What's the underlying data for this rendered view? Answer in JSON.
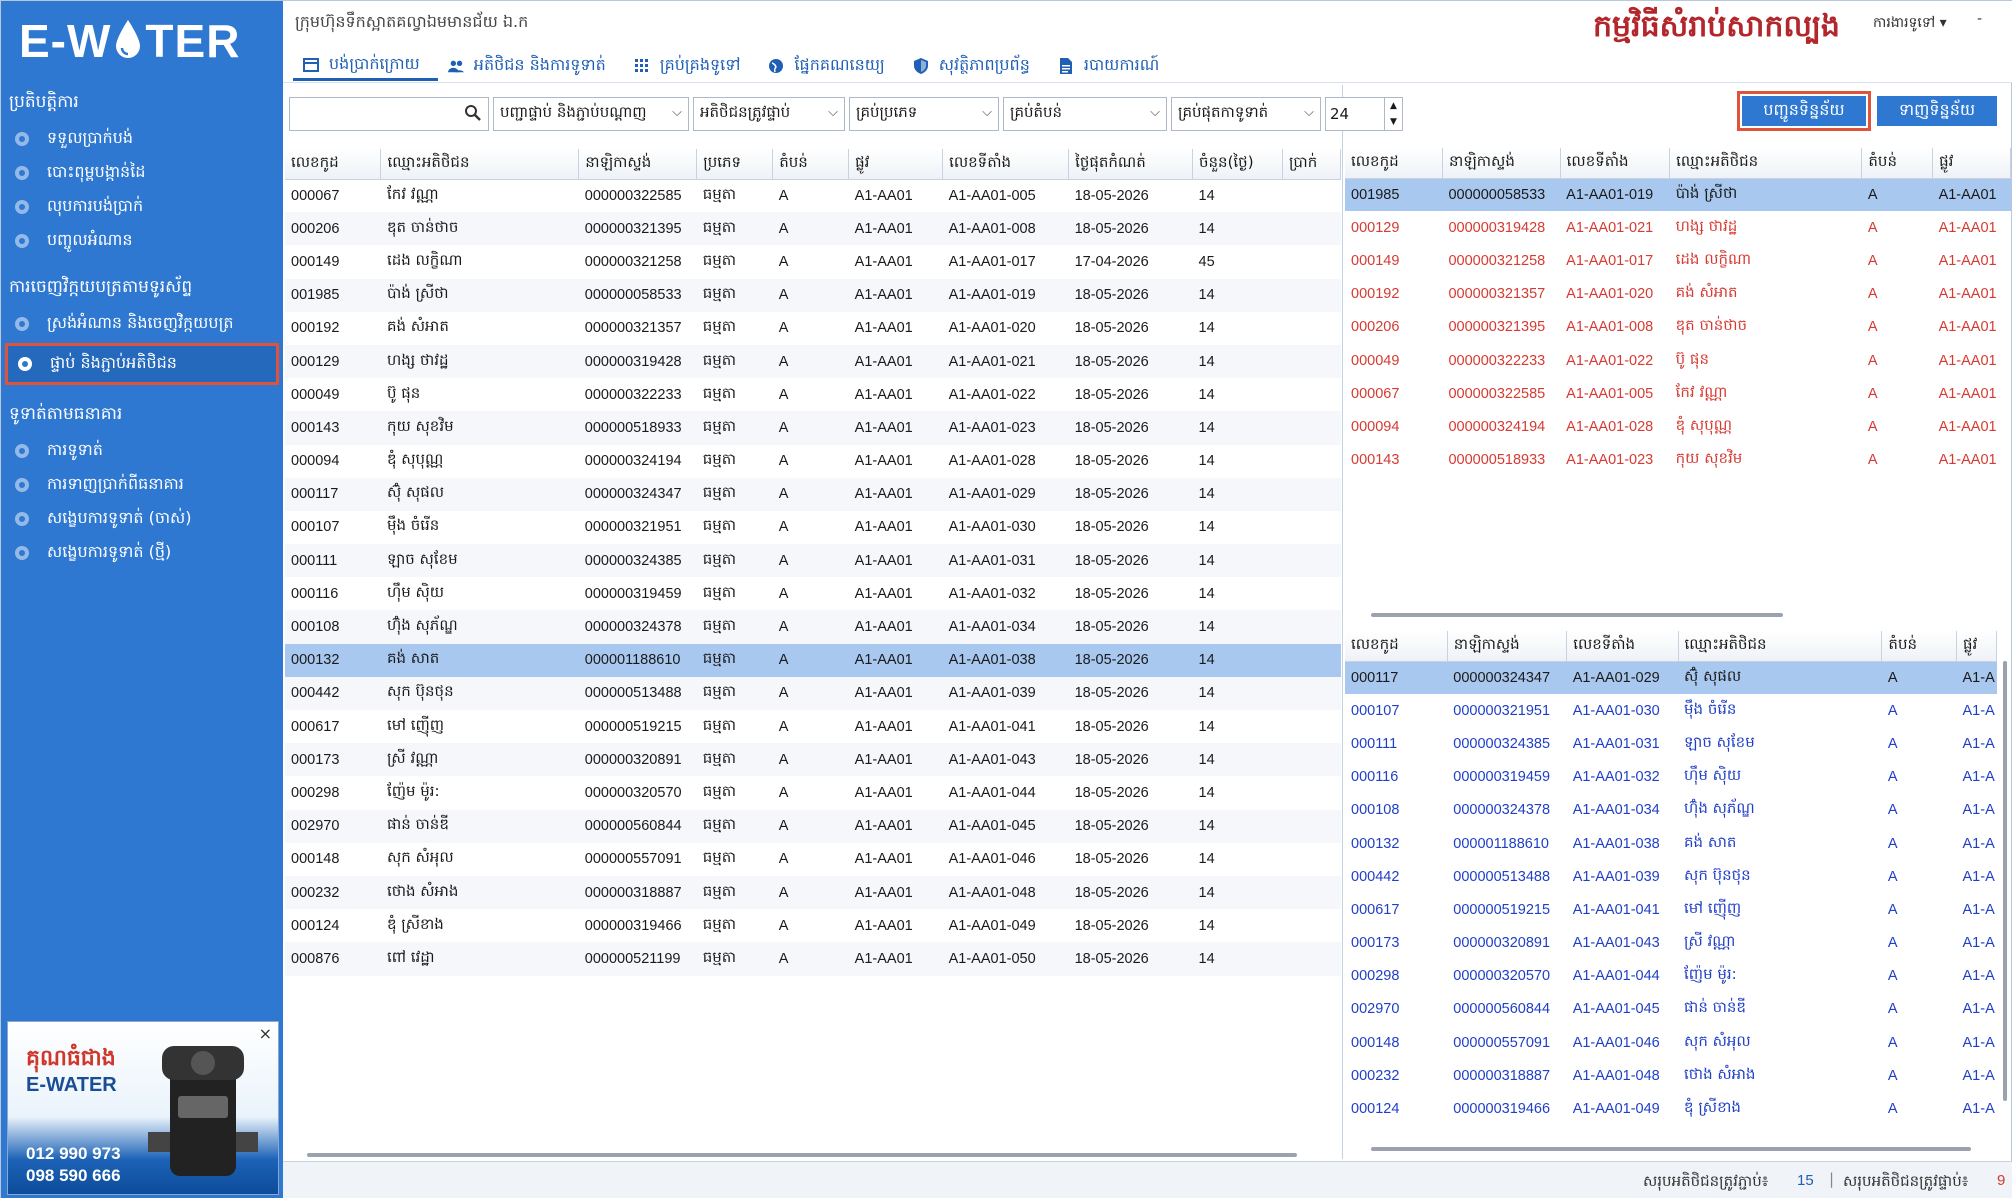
{
  "sidebar": {
    "logo_left": "E-W",
    "logo_right": "TER",
    "sections": [
      {
        "title": "ប្រតិបត្តិការ",
        "items": [
          "ទទួលប្រាក់បង់",
          "បោះពុម្ពបង្កាន់ដៃ",
          "លុបការបង់ប្រាក់",
          "បញ្ចូលអំណាន"
        ]
      },
      {
        "title": "ការចេញវិក្កយបត្រតាមទូរស័ព្ទ",
        "items": [
          "ស្រង់អំណាន និងចេញវិក្កយបត្រ",
          "ផ្ទាប់ និងភ្ជាប់អតិថិជន"
        ]
      },
      {
        "title": "ទូទាត់តាមធនាគារ",
        "items": [
          "ការទូទាត់",
          "ការទាញប្រាក់ពីធនាគារ",
          "សង្ខេបការទូទាត់ (ចាស់)",
          "សង្ខេបការទូទាត់ (ថ្មី)"
        ]
      }
    ],
    "ad": {
      "title": "គុណធំជាង",
      "brand": "E-WATER",
      "phone1": "012 990 973",
      "phone2": "098 590 666",
      "close": "×"
    }
  },
  "header": {
    "org": "ក្រុមហ៊ុនទឹកស្អាតគល្វាឯមមានជ័យ ឯ.ក",
    "app_title": "កម្មវិធីសំរាប់សាកល្បង",
    "user": "ការងារទូទៅ ▾",
    "win_min": "-",
    "tabs": [
      {
        "label": "បង់ប្រាក់ក្រោយ",
        "icon": "card-icon"
      },
      {
        "label": "អតិថិជន និងការទូទាត់",
        "icon": "users-icon"
      },
      {
        "label": "គ្រប់គ្រងទូទៅ",
        "icon": "grid-icon"
      },
      {
        "label": "ផ្នែកគណនេយ្យ",
        "icon": "globe-icon"
      },
      {
        "label": "សុវត្ថិភាពប្រព័ន្ធ",
        "icon": "shield-icon"
      },
      {
        "label": "របាយការណ៍",
        "icon": "report-icon"
      }
    ]
  },
  "filters": {
    "search_value": "",
    "f1": "បញ្ជាផ្ទាប់ និងភ្ជាប់បណ្តាញ",
    "f2": "អតិថិជនត្រូវផ្ទាប់",
    "f3": "គ្រប់ប្រភេទ",
    "f4": "គ្រប់តំបន់",
    "f5": "គ្រប់ផុតកាទូទាត់",
    "days": "24"
  },
  "left_table": {
    "columns": [
      "លេខកូដ",
      "ឈ្មោះអតិថិជន",
      "នាឡិកាស្ទង់",
      "ប្រភេទ",
      "តំបន់",
      "ផ្លូវ",
      "លេខទីតាំង",
      "ថ្ងៃផុតកំណត់",
      "ចំនួន(ថ្ងៃ)",
      "ប្រាក់"
    ],
    "rows": [
      [
        "000067",
        "កែវ វណ្ណា",
        "000000322585",
        "ធម្មតា",
        "A",
        "A1-AA01",
        "A1-AA01-005",
        "18-05-2026",
        "14"
      ],
      [
        "000206",
        "ឌុត ចាន់ថាច",
        "000000321395",
        "ធម្មតា",
        "A",
        "A1-AA01",
        "A1-AA01-008",
        "18-05-2026",
        "14"
      ],
      [
        "000149",
        "ដេង លក្ខិណា",
        "000000321258",
        "ធម្មតា",
        "A",
        "A1-AA01",
        "A1-AA01-017",
        "17-04-2026",
        "45"
      ],
      [
        "001985",
        "ប៉ាង់ ស្រីថា",
        "000000058533",
        "ធម្មតា",
        "A",
        "A1-AA01",
        "A1-AA01-019",
        "18-05-2026",
        "14"
      ],
      [
        "000192",
        "គង់ សំអាត",
        "000000321357",
        "ធម្មតា",
        "A",
        "A1-AA01",
        "A1-AA01-020",
        "18-05-2026",
        "14"
      ],
      [
        "000129",
        "ហង្ស ថាវដ្ឋ",
        "000000319428",
        "ធម្មតា",
        "A",
        "A1-AA01",
        "A1-AA01-021",
        "18-05-2026",
        "14"
      ],
      [
        "000049",
        "ប៊ូ ផុន",
        "000000322233",
        "ធម្មតា",
        "A",
        "A1-AA01",
        "A1-AA01-022",
        "18-05-2026",
        "14"
      ],
      [
        "000143",
        "កុយ សុខវិម",
        "000000518933",
        "ធម្មតា",
        "A",
        "A1-AA01",
        "A1-AA01-023",
        "18-05-2026",
        "14"
      ],
      [
        "000094",
        "ឌុំ សុបុណ្ណ",
        "000000324194",
        "ធម្មតា",
        "A",
        "A1-AA01",
        "A1-AA01-028",
        "18-05-2026",
        "14"
      ],
      [
        "000117",
        "ស៊ុំ សុផល",
        "000000324347",
        "ធម្មតា",
        "A",
        "A1-AA01",
        "A1-AA01-029",
        "18-05-2026",
        "14"
      ],
      [
        "000107",
        "ម៉ឹង ចំរើន",
        "000000321951",
        "ធម្មតា",
        "A",
        "A1-AA01",
        "A1-AA01-030",
        "18-05-2026",
        "14"
      ],
      [
        "000111",
        "ឡាច សុខែម",
        "000000324385",
        "ធម្មតា",
        "A",
        "A1-AA01",
        "A1-AA01-031",
        "18-05-2026",
        "14"
      ],
      [
        "000116",
        "ហ៊ឹម សុិយ",
        "000000319459",
        "ធម្មតា",
        "A",
        "A1-AA01",
        "A1-AA01-032",
        "18-05-2026",
        "14"
      ],
      [
        "000108",
        "ហ៊ុំង សុភ័ណ្ឌ",
        "000000324378",
        "ធម្មតា",
        "A",
        "A1-AA01",
        "A1-AA01-034",
        "18-05-2026",
        "14"
      ],
      [
        "000132",
        "គង់ សាត",
        "000001188610",
        "ធម្មតា",
        "A",
        "A1-AA01",
        "A1-AA01-038",
        "18-05-2026",
        "14"
      ],
      [
        "000442",
        "សុក ប៊ុនថុន",
        "000000513488",
        "ធម្មតា",
        "A",
        "A1-AA01",
        "A1-AA01-039",
        "18-05-2026",
        "14"
      ],
      [
        "000617",
        "មៅ ញ៉ើញ",
        "000000519215",
        "ធម្មតា",
        "A",
        "A1-AA01",
        "A1-AA01-041",
        "18-05-2026",
        "14"
      ],
      [
        "000173",
        "ស្រី វណ្ណា",
        "000000320891",
        "ធម្មតា",
        "A",
        "A1-AA01",
        "A1-AA01-043",
        "18-05-2026",
        "14"
      ],
      [
        "000298",
        "ញ៉ែម ម៉ូរ:",
        "000000320570",
        "ធម្មតា",
        "A",
        "A1-AA01",
        "A1-AA01-044",
        "18-05-2026",
        "14"
      ],
      [
        "002970",
        "ផាន់ ចាន់ឌី",
        "000000560844",
        "ធម្មតា",
        "A",
        "A1-AA01",
        "A1-AA01-045",
        "18-05-2026",
        "14"
      ],
      [
        "000148",
        "សុក សំអុល",
        "000000557091",
        "ធម្មតា",
        "A",
        "A1-AA01",
        "A1-AA01-046",
        "18-05-2026",
        "14"
      ],
      [
        "000232",
        "ថោង សំអាង",
        "000000318887",
        "ធម្មតា",
        "A",
        "A1-AA01",
        "A1-AA01-048",
        "18-05-2026",
        "14"
      ],
      [
        "000124",
        "ឌុំ ស្រីខាង",
        "000000319466",
        "ធម្មតា",
        "A",
        "A1-AA01",
        "A1-AA01-049",
        "18-05-2026",
        "14"
      ],
      [
        "000876",
        "ពៅ វេដ្ឋា",
        "000000521199",
        "ធម្មតា",
        "A",
        "A1-AA01",
        "A1-AA01-050",
        "18-05-2026",
        "14"
      ]
    ],
    "selected_index": 14
  },
  "right_buttons": {
    "send": "បញ្ជូនទិន្នន័យ",
    "pull": "ទាញទិន្នន័យ"
  },
  "right_top_table": {
    "columns": [
      "លេខកូដ",
      "នាឡិកាស្ទង់",
      "លេខទីតាំង",
      "ឈ្មោះអតិថិជន",
      "តំបន់",
      "ផ្លូវ"
    ],
    "rows": [
      [
        "001985",
        "000000058533",
        "A1-AA01-019",
        "ប៉ាង់ ស្រីថា",
        "A",
        "A1-AA01"
      ],
      [
        "000129",
        "000000319428",
        "A1-AA01-021",
        "ហង្ស ថាវដ្ឋ",
        "A",
        "A1-AA01"
      ],
      [
        "000149",
        "000000321258",
        "A1-AA01-017",
        "ដេង លក្ខិណា",
        "A",
        "A1-AA01"
      ],
      [
        "000192",
        "000000321357",
        "A1-AA01-020",
        "គង់ សំអាត",
        "A",
        "A1-AA01"
      ],
      [
        "000206",
        "000000321395",
        "A1-AA01-008",
        "ឌុត ចាន់ថាច",
        "A",
        "A1-AA01"
      ],
      [
        "000049",
        "000000322233",
        "A1-AA01-022",
        "ប៊ូ ផុន",
        "A",
        "A1-AA01"
      ],
      [
        "000067",
        "000000322585",
        "A1-AA01-005",
        "កែវ វណ្ណា",
        "A",
        "A1-AA01"
      ],
      [
        "000094",
        "000000324194",
        "A1-AA01-028",
        "ឌុំ សុបុណ្ណ",
        "A",
        "A1-AA01"
      ],
      [
        "000143",
        "000000518933",
        "A1-AA01-023",
        "កុយ សុខវិម",
        "A",
        "A1-AA01"
      ]
    ],
    "selected_index": 0
  },
  "right_bottom_table": {
    "columns": [
      "លេខកូដ",
      "នាឡិកាស្ទង់",
      "លេខទីតាំង",
      "ឈ្មោះអតិថិជន",
      "តំបន់",
      "ផ្លូវ"
    ],
    "rows": [
      [
        "000117",
        "000000324347",
        "A1-AA01-029",
        "ស៊ុំ សុផល",
        "A",
        "A1-A"
      ],
      [
        "000107",
        "000000321951",
        "A1-AA01-030",
        "ម៉ឹង ចំរើន",
        "A",
        "A1-A"
      ],
      [
        "000111",
        "000000324385",
        "A1-AA01-031",
        "ឡាច សុខែម",
        "A",
        "A1-A"
      ],
      [
        "000116",
        "000000319459",
        "A1-AA01-032",
        "ហ៊ឹម សុិយ",
        "A",
        "A1-A"
      ],
      [
        "000108",
        "000000324378",
        "A1-AA01-034",
        "ហ៊ុំង សុភ័ណ្ឌ",
        "A",
        "A1-A"
      ],
      [
        "000132",
        "000001188610",
        "A1-AA01-038",
        "គង់ សាត",
        "A",
        "A1-A"
      ],
      [
        "000442",
        "000000513488",
        "A1-AA01-039",
        "សុក ប៊ុនថុន",
        "A",
        "A1-A"
      ],
      [
        "000617",
        "000000519215",
        "A1-AA01-041",
        "មៅ ញ៉ើញ",
        "A",
        "A1-A"
      ],
      [
        "000173",
        "000000320891",
        "A1-AA01-043",
        "ស្រី វណ្ណា",
        "A",
        "A1-A"
      ],
      [
        "000298",
        "000000320570",
        "A1-AA01-044",
        "ញ៉ែម ម៉ូរ:",
        "A",
        "A1-A"
      ],
      [
        "002970",
        "000000560844",
        "A1-AA01-045",
        "ផាន់ ចាន់ឌី",
        "A",
        "A1-A"
      ],
      [
        "000148",
        "000000557091",
        "A1-AA01-046",
        "សុក សំអុល",
        "A",
        "A1-A"
      ],
      [
        "000232",
        "000000318887",
        "A1-AA01-048",
        "ថោង សំអាង",
        "A",
        "A1-A"
      ],
      [
        "000124",
        "000000319466",
        "A1-AA01-049",
        "ឌុំ ស្រីខាង",
        "A",
        "A1-A"
      ]
    ],
    "selected_index": 0
  },
  "status": {
    "connected_label": "សរុបអតិថិជនត្រូវភ្ជាប់៖",
    "connected_value": "15",
    "separator": "|",
    "disconnected_label": "សរុបអតិថិជនត្រូវផ្ទាប់៖",
    "disconnected_value": "9"
  },
  "colors": {
    "sidebar": "#2f78d2",
    "accent": "#1f5fb5",
    "title": "#b3262b",
    "highlight": "#e0533b",
    "red_rows": "#d63a32",
    "blue_rows": "#1f3fc7"
  }
}
